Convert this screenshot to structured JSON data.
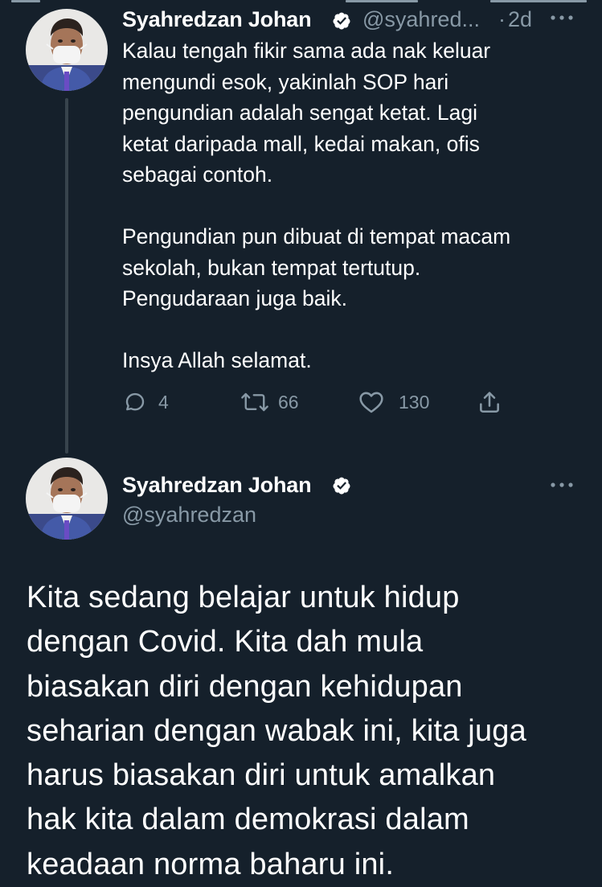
{
  "tweet_reply": {
    "author_name": "Syahredzan Johan",
    "handle": "@syahred...",
    "separator": "·",
    "time": "2d",
    "paragraphs": [
      "Kalau tengah fikir sama ada nak keluar\nmengundi esok, yakinlah SOP hari\npengundian adalah sengat ketat. Lagi\nketat daripada mall, kedai makan, ofis\nsebagai contoh.",
      "Pengundian pun dibuat di tempat macam\nsekolah, bukan tempat tertutup.\nPengudaraan juga baik.",
      "Insya Allah selamat."
    ],
    "actions": {
      "reply_count": "4",
      "retweet_count": "66",
      "like_count": "130"
    }
  },
  "tweet_main": {
    "author_name": "Syahredzan Johan",
    "handle": "@syahredzan",
    "text": "Kita sedang belajar untuk hidup\ndengan Covid. Kita dah mula\nbiasakan diri dengan kehidupan\nseharian dengan wabak ini, kita juga\nharus biasakan diri untuk amalkan\nhak kita dalam demokrasi dalam\nkeadaan norma baharu ini."
  },
  "colors": {
    "background": "#15202b",
    "text_primary": "#ffffff",
    "text_secondary": "#8899a6",
    "thread_line": "#38444d",
    "verified_badge": "#ffffff"
  },
  "icons": {
    "verified": "verified-badge-icon",
    "more": "more-horizontal-icon",
    "reply": "reply-bubble-icon",
    "retweet": "retweet-icon",
    "like": "heart-icon",
    "share": "share-icon"
  }
}
